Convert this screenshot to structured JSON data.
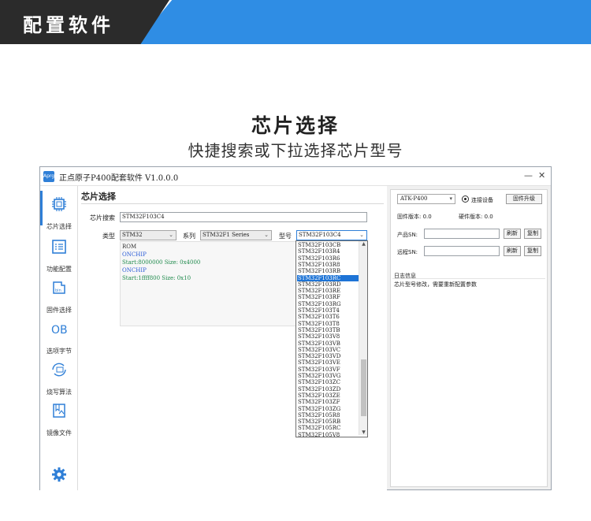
{
  "banner": {
    "title": "配置软件"
  },
  "heading": {
    "title": "芯片选择",
    "subtitle": "快捷搜索或下拉选择芯片型号"
  },
  "window": {
    "logo": "Aprg",
    "title": "正点原子P400配套软件 V1.0.0.0",
    "min": "—",
    "close": "✕"
  },
  "nav": [
    {
      "label": "芯片选择",
      "icon": "chip-icon"
    },
    {
      "label": "功能配置",
      "icon": "config-icon"
    },
    {
      "label": "固件选择",
      "icon": "firmware-icon"
    },
    {
      "label": "选项字节",
      "icon": "option-bytes-icon"
    },
    {
      "label": "烧写算法",
      "icon": "algorithm-icon"
    },
    {
      "label": "镜像文件",
      "icon": "image-file-icon"
    }
  ],
  "settings_icon": "gear-icon",
  "chip": {
    "section_title": "芯片选择",
    "search_label": "芯片搜索",
    "search_value": "STM32F103C4",
    "type_label": "类型",
    "type_value": "STM32",
    "series_label": "系列",
    "series_value": "STM32F1 Series",
    "model_label": "型号",
    "model_value": "STM32F103C4"
  },
  "memory": {
    "lines": [
      {
        "text": "ROM",
        "kind": "head"
      },
      {
        "text": "ONCHIP",
        "kind": "name"
      },
      {
        "text": "Start:8000000   Size: 0x4000",
        "kind": "info"
      },
      {
        "text": "ONCHIP",
        "kind": "name"
      },
      {
        "text": "Start:1ffff800  Size: 0x10",
        "kind": "info"
      }
    ]
  },
  "dropdown": {
    "selected_index": 5,
    "items": [
      "STM32F103CB",
      "STM32F103R4",
      "STM32F103R6",
      "STM32F103R8",
      "STM32F103RB",
      "STM32F103RC",
      "STM32F103RD",
      "STM32F103RE",
      "STM32F103RF",
      "STM32F103RG",
      "STM32F103T4",
      "STM32F103T6",
      "STM32F103T8",
      "STM32F103TB",
      "STM32F103V8",
      "STM32F103VB",
      "STM32F103VC",
      "STM32F103VD",
      "STM32F103VE",
      "STM32F103VF",
      "STM32F103VG",
      "STM32F103ZC",
      "STM32F103ZD",
      "STM32F103ZE",
      "STM32F103ZF",
      "STM32F103ZG",
      "STM32F105R8",
      "STM32F105RB",
      "STM32F105RC",
      "STM32F105V8"
    ],
    "arrow_up": "▲",
    "arrow_down": "▼"
  },
  "device": {
    "device_value": "ATK-P400",
    "connect_label": "连接设备",
    "upgrade_label": "固件升级",
    "firmware_version": "固件版本: 0.0",
    "hardware_version": "硬件版本: 0.0",
    "product_sn_label": "产品SN:",
    "remote_sn_label": "远程SN:",
    "refresh_label": "刷新",
    "copy_label": "复制"
  },
  "log": {
    "title": "日志信息",
    "message": "芯片型号修改，需要重新配置参数"
  },
  "colors": {
    "accent": "#2f7fd7",
    "banner_blue": "#2f8de4",
    "banner_dark": "#2b2b2b",
    "mem_name": "#2a5bd7",
    "mem_info": "#1f8a4c"
  }
}
